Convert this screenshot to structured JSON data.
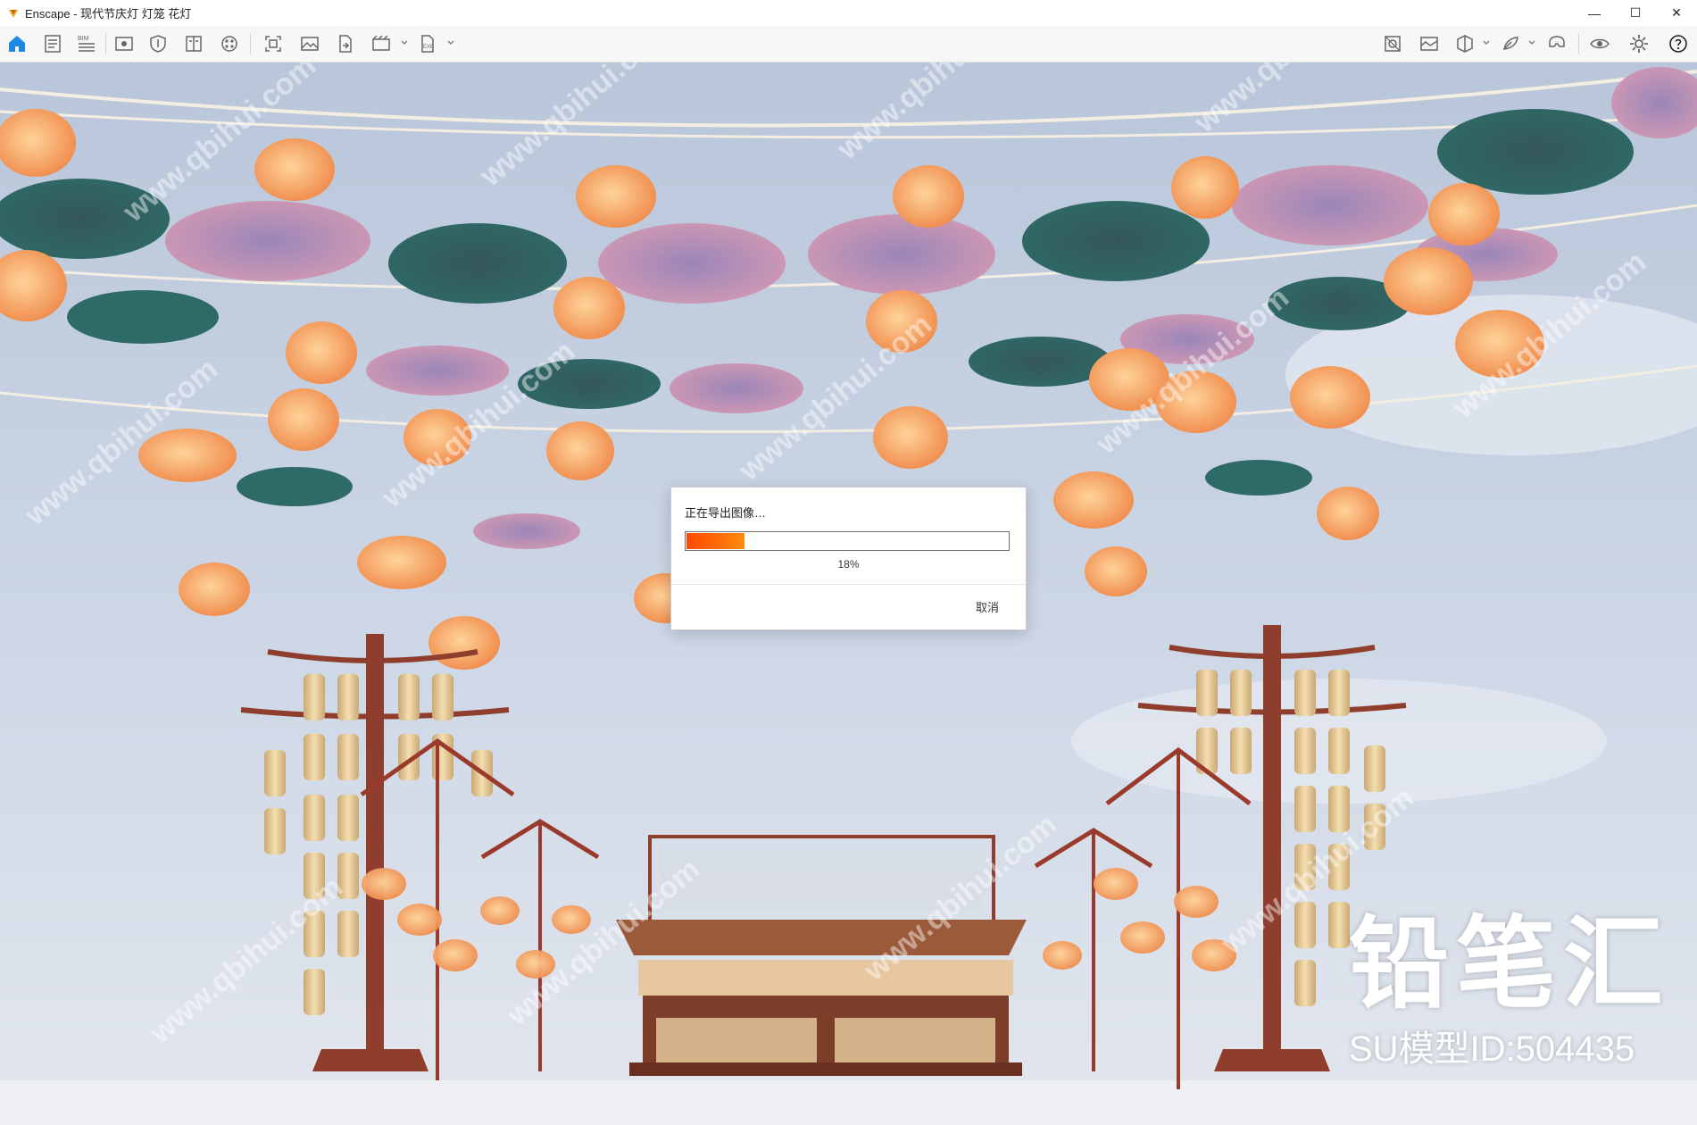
{
  "window": {
    "title": "Enscape - 现代节庆灯 灯笼 花灯",
    "controls": {
      "minimize": "—",
      "maximize": "☐",
      "close": "✕"
    }
  },
  "toolbar": {
    "left_icons": [
      "home-icon",
      "document-icon",
      "bim-icon",
      "eye-view-icon",
      "shield-icon",
      "book-icon",
      "palette-icon",
      "capture-icon",
      "image-icon",
      "file-export-icon",
      "video-icon",
      "exe-export-icon"
    ],
    "right_icons": [
      "asset-library-icon",
      "material-icon",
      "views-icon",
      "settings-visual-icon",
      "vr-icon",
      "visibility-icon",
      "gear-icon",
      "help-icon"
    ],
    "collapse_icon": "chevron-up-icon",
    "bim_label": "BIM",
    "exe_label": "EXE"
  },
  "dialog": {
    "title": "正在导出图像…",
    "progress": 0.18,
    "progress_text": "18%",
    "cancel_label": "取消"
  },
  "watermark": {
    "logo_text": "铅笔汇",
    "id_text": "SU模型ID:504435",
    "diagonal_text": "www.qbihui.com"
  },
  "colors": {
    "accent": "#ff6a00",
    "sky": "#c4d0e2"
  }
}
